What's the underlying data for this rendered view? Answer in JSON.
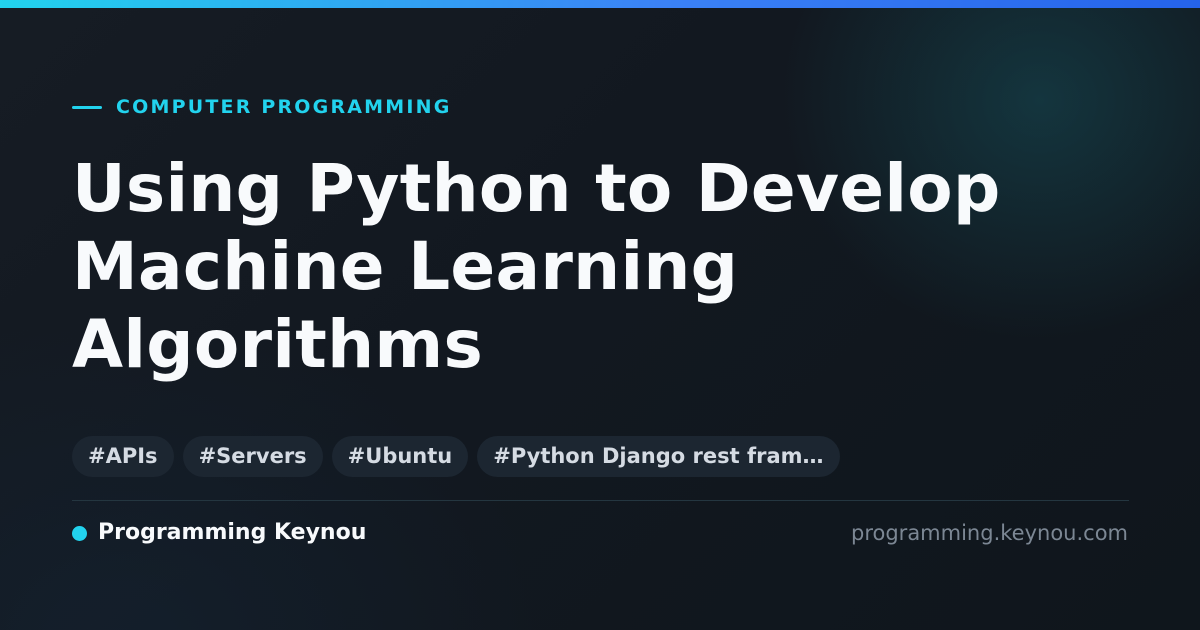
{
  "category": {
    "label": "COMPUTER PROGRAMMING"
  },
  "title": "Using Python to Develop Machine Learning Algorithms",
  "tags": [
    "#APIs",
    "#Servers",
    "#Ubuntu",
    "#Python Django rest fram…"
  ],
  "brand": {
    "name": "Programming Keynou"
  },
  "site": {
    "url": "programming.keynou.com"
  },
  "colors": {
    "accent": "#22d3ee",
    "gradient_end": "#2563eb",
    "background": "#121820",
    "title_text": "#f8fafc",
    "tag_background": "#1c2631",
    "muted_text": "#7c8794"
  }
}
